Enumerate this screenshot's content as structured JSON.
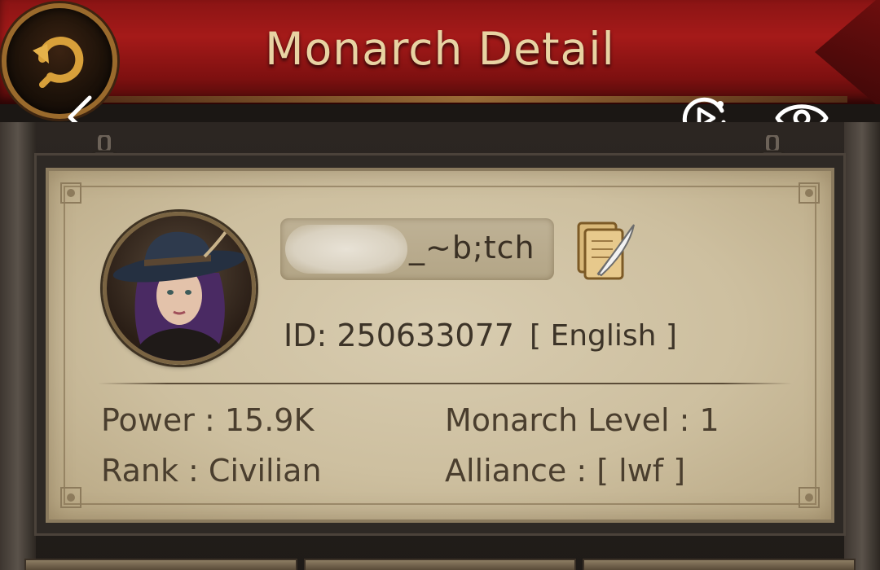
{
  "header": {
    "title": "Monarch Detail",
    "colors": {
      "banner": "#a51a19",
      "title": "#e8d3a3"
    }
  },
  "profile": {
    "name_visible": "_~b;tch",
    "id_text": "ID: 250633077",
    "language": "[ English ]"
  },
  "stats": {
    "power": "Power : 15.9K",
    "rank": "Rank : Civilian",
    "monarch_level": "Monarch Level : 1",
    "alliance": "Alliance :  [ lwf ]"
  },
  "icons": {
    "back": "back-arrow-icon",
    "chevron": "chevron-left-icon",
    "replay": "replay-icon",
    "view": "eye-icon",
    "edit": "quill-scroll-icon"
  }
}
